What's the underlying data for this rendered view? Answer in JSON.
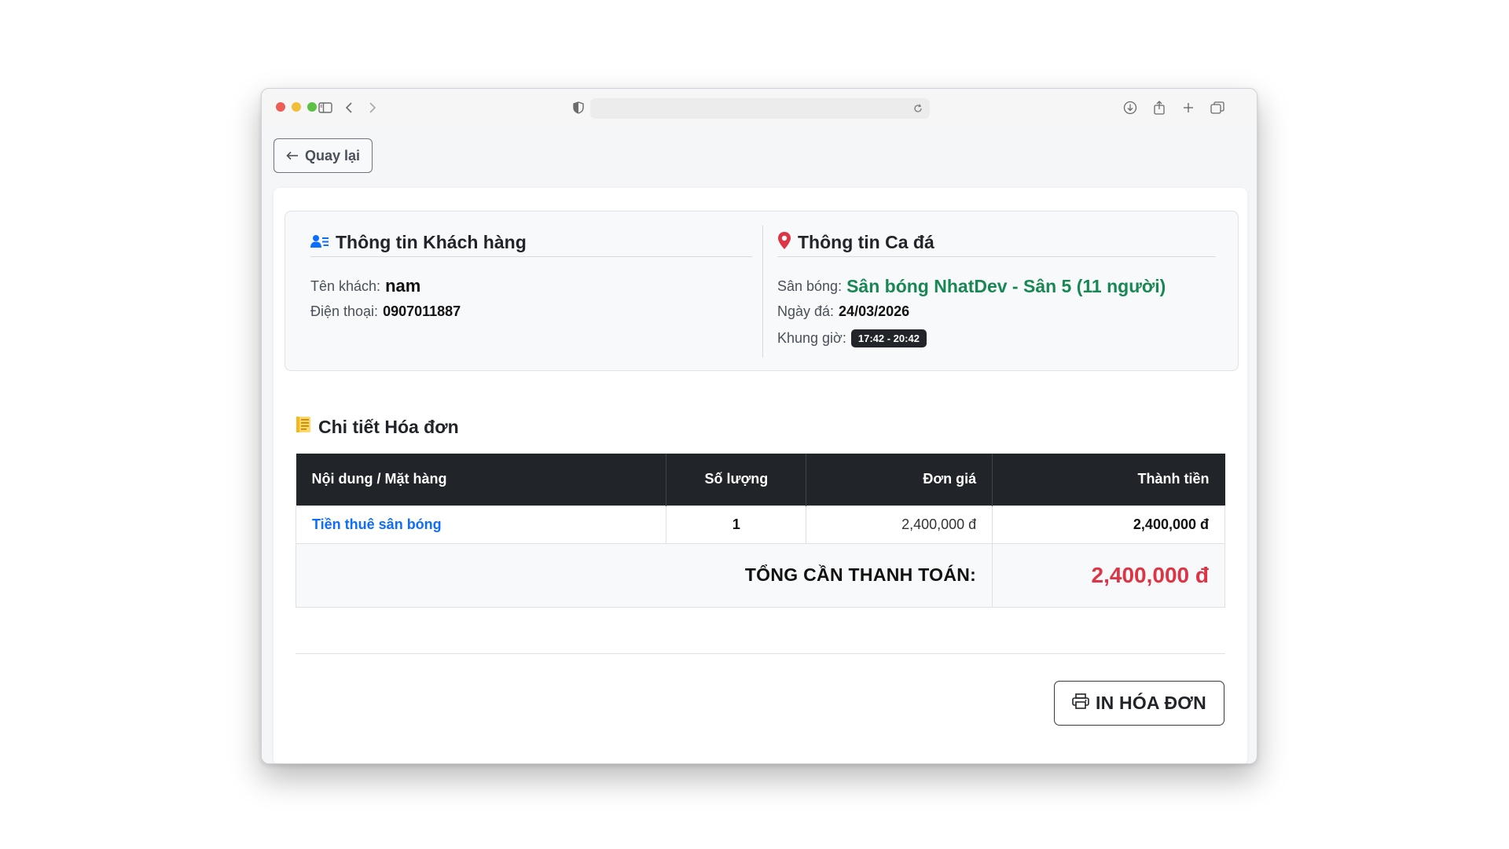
{
  "toolbar": {
    "back_label": "Quay lại",
    "icons": [
      "sidebar-icon",
      "chevron-left-icon",
      "chevron-right-icon",
      "shield-icon",
      "reload-icon",
      "download-icon",
      "share-icon",
      "plus-icon",
      "tabs-icon"
    ]
  },
  "customer": {
    "heading": "Thông tin Khách hàng",
    "name_label": "Tên khách:",
    "name_value": "nam",
    "phone_label": "Điện thoại:",
    "phone_value": "0907011887"
  },
  "session": {
    "heading": "Thông tin Ca đá",
    "field_label": "Sân bóng:",
    "field_value": "Sân bóng NhatDev - Sân 5 (11 người)",
    "date_label": "Ngày đá:",
    "date_value": "24/03/2026",
    "time_label": "Khung giờ:",
    "time_value": "17:42 - 20:42"
  },
  "invoice": {
    "heading": "Chi tiết Hóa đơn",
    "columns": [
      "Nội dung / Mặt hàng",
      "Số lượng",
      "Đơn giá",
      "Thành tiền"
    ],
    "items": [
      {
        "name": "Tiền thuê sân bóng",
        "qty": "1",
        "unit_price": "2,400,000 đ",
        "total": "2,400,000 đ"
      }
    ],
    "total_label": "TỔNG CẦN THANH TOÁN:",
    "total_value": "2,400,000 đ"
  },
  "actions": {
    "print_label": "IN HÓA ĐƠN"
  },
  "colors": {
    "accent_blue": "#0d6efd",
    "field_green": "#198754",
    "total_red": "#dc3545",
    "header_dark": "#212529"
  }
}
